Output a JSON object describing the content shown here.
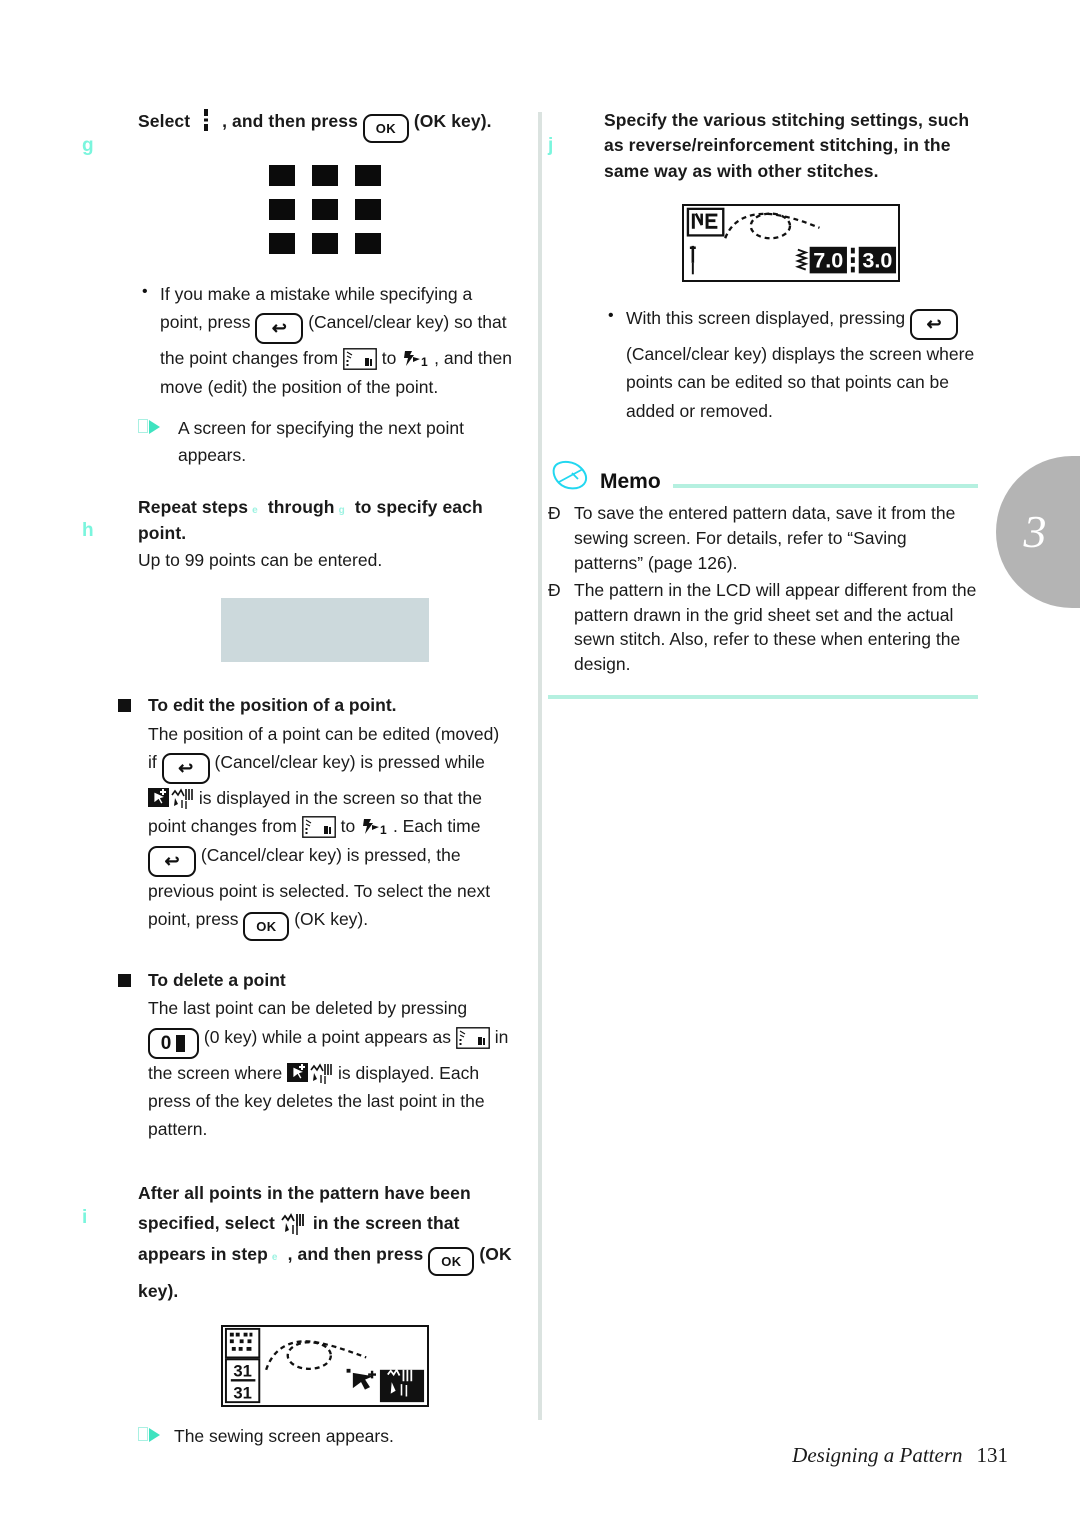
{
  "document": {
    "footer_title": "Designing a Pattern",
    "footer_page": "131",
    "chapter_number": "3"
  },
  "colors": {
    "accent_teal": "#7af5dd",
    "memo_rule": "#b5f0e0",
    "divider": "#dbe3e0",
    "chapter_tab": "#b4b4b4",
    "placeholder": "#ccd9dc",
    "bell_cyan": "#22d7f0"
  },
  "left_column": {
    "step_g": {
      "marker": "g",
      "title_a": "Select",
      "title_b": ", and then press",
      "key_ok": "OK",
      "title_c": "(OK key).",
      "grid_icon_cells": 9,
      "bullets": [
        {
          "parts": [
            "If you make a mistake while specifying a point, press",
            "(Cancel/clear key) so that the point changes from",
            "to",
            ", and then move (edit) the position of the point."
          ]
        }
      ],
      "arrow_note": "A screen for specifying the next point appears."
    },
    "step_h": {
      "marker": "h",
      "title_a": "Repeat steps",
      "ref_1": "e",
      "title_b": "through",
      "ref_2": "g",
      "title_c": "to specify each point.",
      "body": "Up to 99 points can be entered."
    },
    "edit_point": {
      "heading": "To edit the position of a point.",
      "text_a": "The position of a point can be edited (moved) if",
      "text_b": "(Cancel/clear key) is pressed while",
      "text_c": "is displayed in the screen so that the point changes from",
      "text_d": "to",
      "text_e": ". Each time",
      "text_f": "(Cancel/clear key) is pressed, the previous point is selected. To select the next point, press",
      "key_ok": "OK",
      "text_g": "(OK key)."
    },
    "delete_point": {
      "heading": "To delete a point",
      "text_a": "The last point can be deleted by pressing",
      "text_b": "(0 key) while a point appears as",
      "text_c": "in the screen where",
      "text_d": "is displayed. Each press of the key deletes the last point in the pattern."
    },
    "step_i": {
      "marker": "i",
      "title_a": "After all points in the pattern have been specified, select",
      "title_b": "in the screen that appears in step",
      "ref_1": "e",
      "title_c": ", and then press",
      "key_ok": "OK",
      "title_d": "(OK key).",
      "lcd": {
        "counter_top": "31",
        "counter_bottom": "31"
      },
      "arrow_note": "The sewing screen appears."
    }
  },
  "right_column": {
    "step_j": {
      "marker": "j",
      "title": "Specify the various stitching settings, such as reverse/reinforcement stitching, in the same way as with other stitches.",
      "lcd": {
        "value_width": "7.0",
        "value_length": "3.0",
        "label_icon": "NE"
      },
      "bullets": [
        {
          "parts": [
            "With this screen displayed, pressing",
            "(Cancel/clear key) displays the screen where points can be edited so that points can be added or removed."
          ]
        }
      ]
    },
    "memo": {
      "title": "Memo",
      "bullet_glyph": "Ð",
      "items": [
        "To save the entered pattern data, save it from the sewing screen. For details, refer to “Saving patterns” (page 126).",
        "The pattern in the LCD will appear different from the pattern drawn in the grid sheet set and the actual sewn stitch. Also, refer to these when entering the design."
      ]
    }
  },
  "icons": {
    "ok_key": "ok-key-icon",
    "cancel_key": "cancel-clear-key-icon",
    "zero_key": "zero-key-icon",
    "point_set": "point-set-icon",
    "point_move": "point-move-icon",
    "pattern_cursor": "pattern-cursor-icon",
    "stitch_finish": "stitch-finish-icon",
    "memo_bell": "memo-bell-icon",
    "grid_select": "grid-select-icon"
  }
}
